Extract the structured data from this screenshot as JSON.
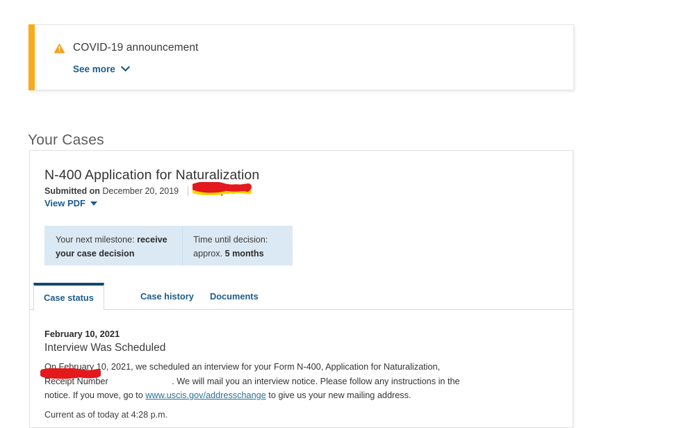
{
  "alert": {
    "icon": "warning-triangle-icon",
    "title": "COVID-19 announcement",
    "see_more_label": "See more",
    "chevron_icon": "chevron-down-icon",
    "accent_color": "#fbaa19"
  },
  "section": {
    "title": "Your Cases"
  },
  "case": {
    "title": "N-400 Application for Naturalization",
    "submitted_label": "Submitted on",
    "submitted_date": "December 20, 2019",
    "receipt_label": "Receipt #",
    "receipt_value": "",
    "view_pdf_label": "View PDF",
    "milestone": {
      "next_label": "Your next milestone:",
      "next_value": "receive your case decision",
      "time_label": "Time until decision:",
      "time_prefix": "approx.",
      "time_value": "5 months"
    },
    "tabs": [
      {
        "label": "Case status",
        "active": true
      },
      {
        "label": "Case history",
        "active": false
      },
      {
        "label": "Documents",
        "active": false
      }
    ],
    "status": {
      "date": "February 10, 2021",
      "heading": "Interview Was Scheduled",
      "body_part1": "On February 10, 2021, we scheduled an interview for your Form N-400, Application for Naturalization, Receipt Number ",
      "body_part2": ". We will mail you an interview notice. Please follow any instructions in the notice. If you move, go to ",
      "link_text": "www.uscis.gov/addresschange",
      "body_part3": " to give us your new mailing address.",
      "current_as_of": "Current as of today at 4:28 p.m."
    }
  },
  "colors": {
    "link": "#1b5c8c",
    "tab_active_border": "#11486f",
    "milestone_bg": "#dbe9f4",
    "redaction_red": "#e01b1b",
    "redaction_yellow": "#ffd400"
  }
}
